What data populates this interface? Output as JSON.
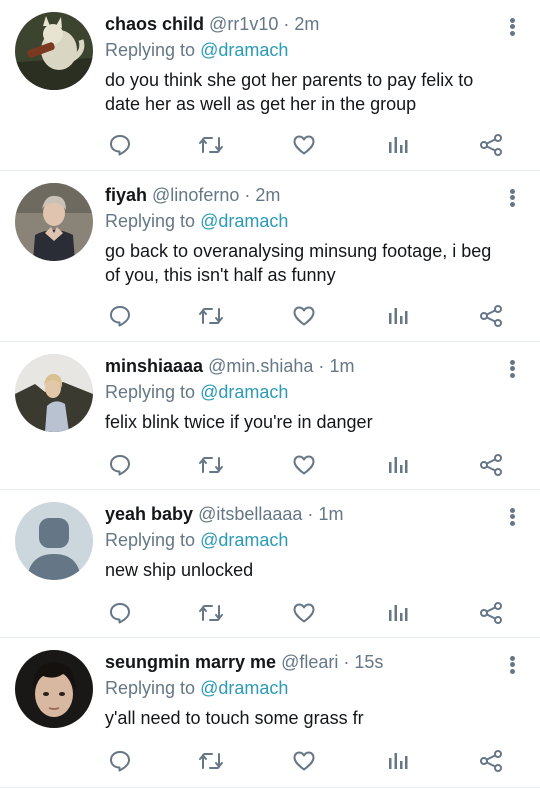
{
  "reply_prefix": "Replying to",
  "tweets": [
    {
      "name": "chaos child",
      "handle": "@rr1v10",
      "time": "2m",
      "reply_to": "@dramach",
      "text": "do you think she got her parents to pay felix to date her as well as get her in the group"
    },
    {
      "name": "fiyah",
      "handle": "@linoferno",
      "time": "2m",
      "reply_to": "@dramach",
      "text": "go back to overanalysing minsung footage, i beg of you, this isn't half as funny"
    },
    {
      "name": "minshiaaaa",
      "handle": "@min.shiaha",
      "time": "1m",
      "reply_to": "@dramach",
      "text": "felix blink twice if you're in danger"
    },
    {
      "name": "yeah baby",
      "handle": "@itsbellaaaa",
      "time": "1m",
      "reply_to": "@dramach",
      "text": "new ship unlocked"
    },
    {
      "name": "seungmin marry me",
      "handle": "@fleari",
      "time": "15s",
      "reply_to": "@dramach",
      "text": "y'all need to touch some grass fr"
    }
  ],
  "icons": {
    "reply": "speech-bubble-icon",
    "retweet": "retweet-icon",
    "like": "heart-icon",
    "stats": "bar-chart-icon",
    "share": "share-icon",
    "more": "vertical-dots-icon"
  },
  "colors": {
    "icon": "#657786",
    "link": "#1da1f2",
    "divider": "#e6ecf0"
  }
}
